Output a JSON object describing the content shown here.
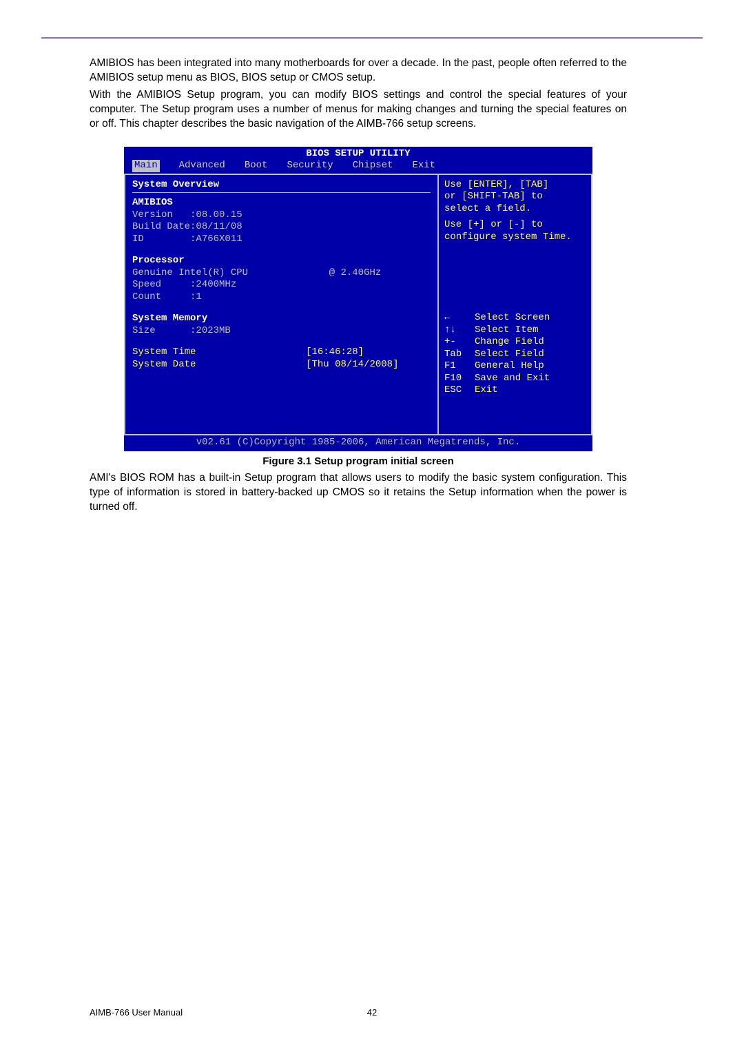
{
  "toprule": true,
  "intro": {
    "p1": "AMIBIOS has been integrated into many motherboards for over a decade. In the past, people often referred to the AMIBIOS setup menu as BIOS, BIOS setup or CMOS setup.",
    "p2": "With the AMIBIOS Setup program, you can modify BIOS settings and control the special features of your computer. The Setup program uses a number of menus for making changes and turning the special features on or off. This chapter describes the basic navigation of the AIMB-766 setup screens."
  },
  "bios": {
    "title": "BIOS SETUP UTILITY",
    "tabs": [
      "Main",
      "Advanced",
      "Boot",
      "Security",
      "Chipset",
      "Exit"
    ],
    "active_tab_index": 0,
    "left": {
      "overview_title": "System Overview",
      "amibios_label": "AMIBIOS",
      "version_label": "Version   :08.00.15",
      "builddate_label": "Build Date:08/11/08",
      "id_label": "ID        :A766X011",
      "processor_label": "Processor",
      "cpu_name": "Genuine Intel(R) CPU",
      "cpu_at": "@ 2.40GHz",
      "speed_label": "Speed     :2400MHz",
      "count_label": "Count     :1",
      "memory_label": "System Memory",
      "size_label": "Size      :2023MB",
      "time_label": "System Time",
      "time_value": "[16:46:28]",
      "date_label": "System Date",
      "date_value": "[Thu 08/14/2008]"
    },
    "right": {
      "help1": "Use [ENTER], [TAB]",
      "help2": "or [SHIFT-TAB] to",
      "help3": "select a field.",
      "help4": "Use [+] or [-] to",
      "help5": "configure system Time.",
      "keys": [
        {
          "k": "←",
          "v": "Select Screen"
        },
        {
          "k": "↑↓",
          "v": "Select Item"
        },
        {
          "k": "+-",
          "v": "Change Field"
        },
        {
          "k": "Tab",
          "v": "Select Field"
        },
        {
          "k": "F1",
          "v": "General Help"
        },
        {
          "k": "F10",
          "v": "Save and Exit"
        },
        {
          "k": "ESC",
          "v": "Exit"
        }
      ]
    },
    "footer": "v02.61 (C)Copyright 1985-2006, American Megatrends, Inc."
  },
  "figure_caption": "Figure 3.1 Setup program initial screen",
  "post": "AMI's BIOS ROM has a built-in Setup program that allows users to modify the basic system configuration. This type of information is stored in battery-backed up CMOS so it retains the Setup information when the power is turned off.",
  "footer": {
    "manual": "AIMB-766 User Manual",
    "page": "42"
  }
}
